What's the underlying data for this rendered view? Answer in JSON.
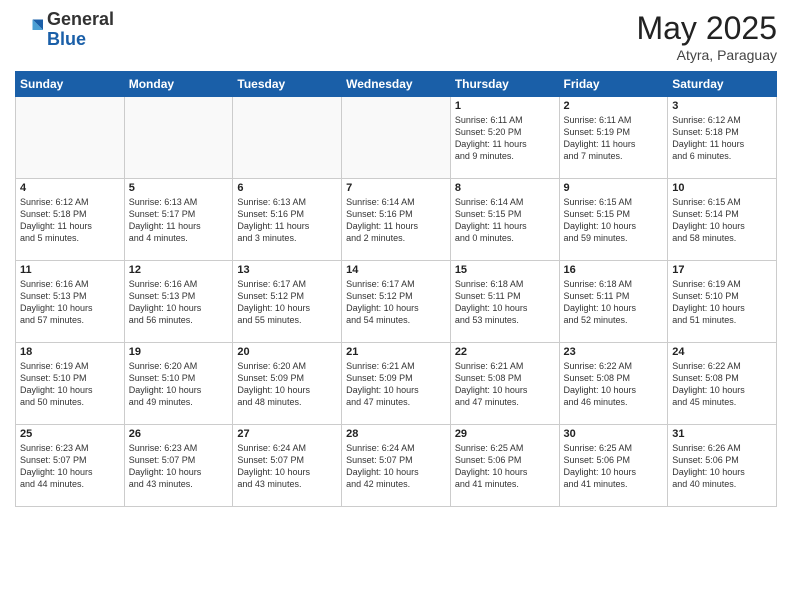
{
  "header": {
    "logo_general": "General",
    "logo_blue": "Blue",
    "month_title": "May 2025",
    "location": "Atyra, Paraguay"
  },
  "days_of_week": [
    "Sunday",
    "Monday",
    "Tuesday",
    "Wednesday",
    "Thursday",
    "Friday",
    "Saturday"
  ],
  "weeks": [
    [
      {
        "day": "",
        "info": ""
      },
      {
        "day": "",
        "info": ""
      },
      {
        "day": "",
        "info": ""
      },
      {
        "day": "",
        "info": ""
      },
      {
        "day": "1",
        "info": "Sunrise: 6:11 AM\nSunset: 5:20 PM\nDaylight: 11 hours\nand 9 minutes."
      },
      {
        "day": "2",
        "info": "Sunrise: 6:11 AM\nSunset: 5:19 PM\nDaylight: 11 hours\nand 7 minutes."
      },
      {
        "day": "3",
        "info": "Sunrise: 6:12 AM\nSunset: 5:18 PM\nDaylight: 11 hours\nand 6 minutes."
      }
    ],
    [
      {
        "day": "4",
        "info": "Sunrise: 6:12 AM\nSunset: 5:18 PM\nDaylight: 11 hours\nand 5 minutes."
      },
      {
        "day": "5",
        "info": "Sunrise: 6:13 AM\nSunset: 5:17 PM\nDaylight: 11 hours\nand 4 minutes."
      },
      {
        "day": "6",
        "info": "Sunrise: 6:13 AM\nSunset: 5:16 PM\nDaylight: 11 hours\nand 3 minutes."
      },
      {
        "day": "7",
        "info": "Sunrise: 6:14 AM\nSunset: 5:16 PM\nDaylight: 11 hours\nand 2 minutes."
      },
      {
        "day": "8",
        "info": "Sunrise: 6:14 AM\nSunset: 5:15 PM\nDaylight: 11 hours\nand 0 minutes."
      },
      {
        "day": "9",
        "info": "Sunrise: 6:15 AM\nSunset: 5:15 PM\nDaylight: 10 hours\nand 59 minutes."
      },
      {
        "day": "10",
        "info": "Sunrise: 6:15 AM\nSunset: 5:14 PM\nDaylight: 10 hours\nand 58 minutes."
      }
    ],
    [
      {
        "day": "11",
        "info": "Sunrise: 6:16 AM\nSunset: 5:13 PM\nDaylight: 10 hours\nand 57 minutes."
      },
      {
        "day": "12",
        "info": "Sunrise: 6:16 AM\nSunset: 5:13 PM\nDaylight: 10 hours\nand 56 minutes."
      },
      {
        "day": "13",
        "info": "Sunrise: 6:17 AM\nSunset: 5:12 PM\nDaylight: 10 hours\nand 55 minutes."
      },
      {
        "day": "14",
        "info": "Sunrise: 6:17 AM\nSunset: 5:12 PM\nDaylight: 10 hours\nand 54 minutes."
      },
      {
        "day": "15",
        "info": "Sunrise: 6:18 AM\nSunset: 5:11 PM\nDaylight: 10 hours\nand 53 minutes."
      },
      {
        "day": "16",
        "info": "Sunrise: 6:18 AM\nSunset: 5:11 PM\nDaylight: 10 hours\nand 52 minutes."
      },
      {
        "day": "17",
        "info": "Sunrise: 6:19 AM\nSunset: 5:10 PM\nDaylight: 10 hours\nand 51 minutes."
      }
    ],
    [
      {
        "day": "18",
        "info": "Sunrise: 6:19 AM\nSunset: 5:10 PM\nDaylight: 10 hours\nand 50 minutes."
      },
      {
        "day": "19",
        "info": "Sunrise: 6:20 AM\nSunset: 5:10 PM\nDaylight: 10 hours\nand 49 minutes."
      },
      {
        "day": "20",
        "info": "Sunrise: 6:20 AM\nSunset: 5:09 PM\nDaylight: 10 hours\nand 48 minutes."
      },
      {
        "day": "21",
        "info": "Sunrise: 6:21 AM\nSunset: 5:09 PM\nDaylight: 10 hours\nand 47 minutes."
      },
      {
        "day": "22",
        "info": "Sunrise: 6:21 AM\nSunset: 5:08 PM\nDaylight: 10 hours\nand 47 minutes."
      },
      {
        "day": "23",
        "info": "Sunrise: 6:22 AM\nSunset: 5:08 PM\nDaylight: 10 hours\nand 46 minutes."
      },
      {
        "day": "24",
        "info": "Sunrise: 6:22 AM\nSunset: 5:08 PM\nDaylight: 10 hours\nand 45 minutes."
      }
    ],
    [
      {
        "day": "25",
        "info": "Sunrise: 6:23 AM\nSunset: 5:07 PM\nDaylight: 10 hours\nand 44 minutes."
      },
      {
        "day": "26",
        "info": "Sunrise: 6:23 AM\nSunset: 5:07 PM\nDaylight: 10 hours\nand 43 minutes."
      },
      {
        "day": "27",
        "info": "Sunrise: 6:24 AM\nSunset: 5:07 PM\nDaylight: 10 hours\nand 43 minutes."
      },
      {
        "day": "28",
        "info": "Sunrise: 6:24 AM\nSunset: 5:07 PM\nDaylight: 10 hours\nand 42 minutes."
      },
      {
        "day": "29",
        "info": "Sunrise: 6:25 AM\nSunset: 5:06 PM\nDaylight: 10 hours\nand 41 minutes."
      },
      {
        "day": "30",
        "info": "Sunrise: 6:25 AM\nSunset: 5:06 PM\nDaylight: 10 hours\nand 41 minutes."
      },
      {
        "day": "31",
        "info": "Sunrise: 6:26 AM\nSunset: 5:06 PM\nDaylight: 10 hours\nand 40 minutes."
      }
    ]
  ]
}
